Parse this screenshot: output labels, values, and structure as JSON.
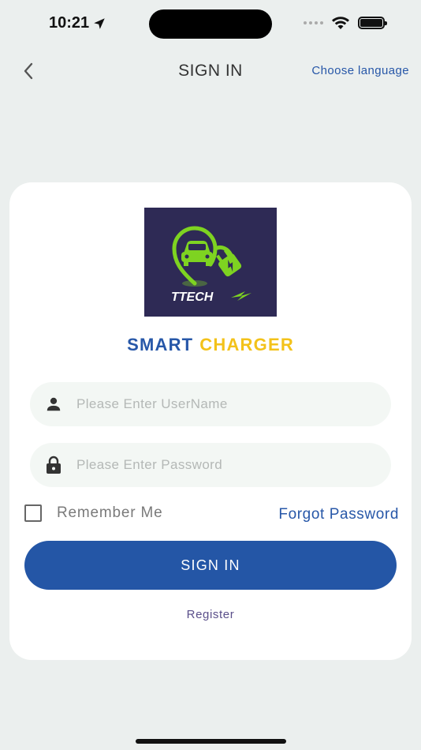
{
  "status_bar": {
    "time": "10:21",
    "icons": [
      "location-arrow-icon",
      "signal-icon",
      "wifi-icon",
      "battery-icon"
    ]
  },
  "header": {
    "back_icon": "chevron-left-icon",
    "title": "SIGN IN",
    "language_link": "Choose language"
  },
  "logo": {
    "text": "TTECH"
  },
  "brand": {
    "part1": "SMART",
    "part2": "CHARGER"
  },
  "form": {
    "username_placeholder": "Please Enter UserName",
    "username_value": "",
    "password_placeholder": "Please Enter Password",
    "password_value": "",
    "remember_label": "Remember Me",
    "remember_checked": false,
    "forgot_label": "Forgot Password",
    "signin_label": "SIGN IN",
    "register_label": "Register"
  },
  "colors": {
    "primary": "#2456a6",
    "accent_yellow": "#f3c21a",
    "logo_bg": "#2e2a55",
    "logo_green": "#7ed321",
    "background": "#ebefee"
  }
}
